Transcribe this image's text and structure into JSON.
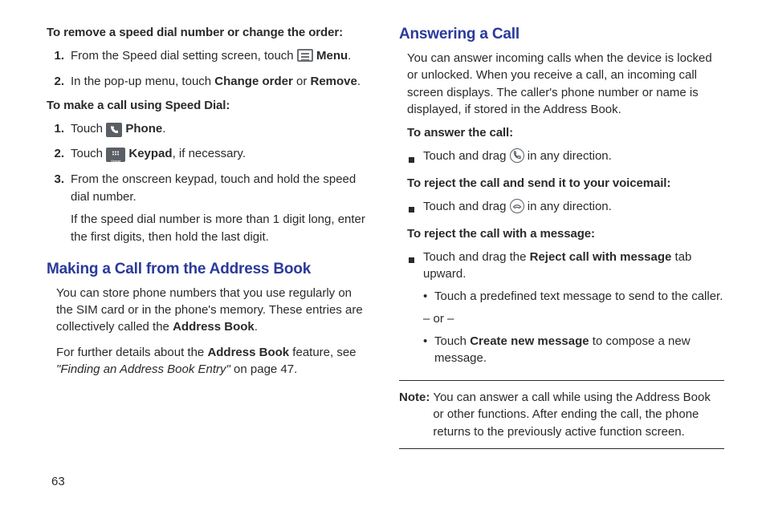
{
  "left": {
    "head_remove": "To remove a speed dial number or change the order:",
    "remove": {
      "n1": "1.",
      "t1a": "From the Speed dial setting screen, touch ",
      "t1b": " Menu",
      "t1c": ".",
      "n2": "2.",
      "t2a": "In the pop-up menu, touch ",
      "t2b": "Change order",
      "t2c": " or ",
      "t2d": "Remove",
      "t2e": "."
    },
    "head_make": "To make a call using Speed Dial:",
    "make": {
      "n1": "1.",
      "t1a": "Touch ",
      "t1b": " Phone",
      "t1c": ".",
      "n2": "2.",
      "t2a": "Touch ",
      "t2b": " Keypad",
      "t2c": ", if necessary.",
      "n3": "3.",
      "t3a": "From the onscreen keypad, touch and hold the speed dial number.",
      "t3b": "If the speed dial number is more than 1 digit long, enter the first digits, then hold the last digit."
    },
    "heading": "Making a Call from the Address Book",
    "p1a": "You can store phone numbers that you use regularly on the SIM card or in the phone's memory. These entries are collectively called the ",
    "p1b": "Address Book",
    "p1c": ".",
    "p2a": "For further details about the ",
    "p2b": "Address Book",
    "p2c": " feature, see ",
    "p2d": "\"Finding an Address Book Entry\"",
    "p2e": " on page 47."
  },
  "right": {
    "heading": "Answering a Call",
    "intro": "You can answer incoming calls when the device is locked or unlocked. When you receive a call, an incoming call screen displays. The caller's phone number or name is displayed, if stored in the Address Book.",
    "head_answer": "To answer the call:",
    "answer_t1": "Touch and drag ",
    "answer_t2": " in any direction.",
    "head_reject_vm": "To reject the call and send it to your voicemail:",
    "rvm_t1": "Touch and drag ",
    "rvm_t2": " in any direction.",
    "head_reject_msg": "To reject the call with a message:",
    "rmsg_t1": "Touch and drag the ",
    "rmsg_t2": "Reject call with message",
    "rmsg_t3": " tab upward.",
    "sub1": "Touch a predefined text message to send to the caller.",
    "sub_or": "– or –",
    "sub2a": "Touch ",
    "sub2b": "Create new message",
    "sub2c": " to compose a new message.",
    "note_label": "Note:",
    "note_text": "You can answer a call while using the Address Book or other functions. After ending the call, the phone returns to the previously active function screen."
  },
  "icons": {
    "keypad_label": "Keypad"
  },
  "page_number": "63"
}
